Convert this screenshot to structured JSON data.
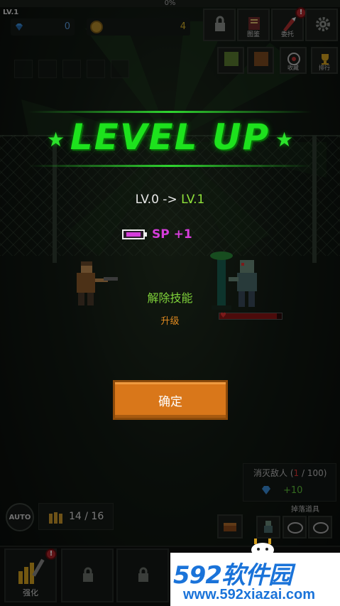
{
  "top": {
    "progress_text": "0%",
    "level_label": "LV.1",
    "gems": "0",
    "coins": "4"
  },
  "menu": {
    "illustrated_label": "图鉴",
    "commission_label": "委托",
    "badge": "!",
    "collection_label": "收藏",
    "rank_label": "排行"
  },
  "level_up": {
    "title": "LEVEL UP",
    "star": "★",
    "from": "LV.0",
    "arrow": " -> ",
    "to": "LV.1",
    "sp_text": "SP +1",
    "skill_name": "解除技能",
    "skill_level": "升级",
    "confirm_label": "确定"
  },
  "battle": {
    "kill_label": "消灭敌人 (",
    "kill_count": "1",
    "kill_total": " / 100)",
    "kill_reward": "+10",
    "drops_label": "掉落道具",
    "auto_label": "AUTO",
    "ammo": "14 / 16"
  },
  "bottom": {
    "upgrade_label": "强化",
    "badge": "!"
  },
  "watermark": {
    "brand": "592软件园",
    "url": "www.592xiazai.com"
  },
  "colors": {
    "level_up_green": "#1de21d",
    "sp_purple": "#d53ddb",
    "button_orange": "#d9771a",
    "skill_green": "#7fd23a",
    "watermark_blue": "#1a73d9"
  }
}
